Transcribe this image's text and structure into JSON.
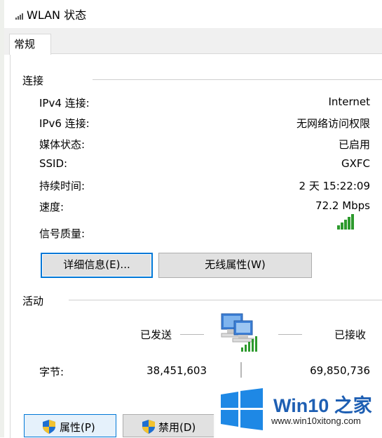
{
  "window": {
    "title": "WLAN 状态"
  },
  "tabs": [
    {
      "label": "常规"
    }
  ],
  "connection": {
    "section_label": "连接",
    "rows": [
      {
        "label": "IPv4 连接:",
        "value": "Internet"
      },
      {
        "label": "IPv6 连接:",
        "value": "无网络访问权限"
      },
      {
        "label": "媒体状态:",
        "value": "已启用"
      },
      {
        "label": "SSID:",
        "value": "GXFC"
      },
      {
        "label": "持续时间:",
        "value": "2 天 15:22:09"
      },
      {
        "label": "速度:",
        "value": "72.2 Mbps"
      }
    ],
    "signal_label": "信号质量:",
    "signal_bars": 5,
    "buttons": {
      "details": "详细信息(E)...",
      "wireless_properties": "无线属性(W)"
    }
  },
  "activity": {
    "section_label": "活动",
    "sent_label": "已发送",
    "received_label": "已接收",
    "bytes_label": "字节:",
    "bytes_sent": "38,451,603",
    "bytes_received": "69,850,736"
  },
  "footer": {
    "properties_button": "属性(P)",
    "disable_button": "禁用(D)"
  },
  "watermark": {
    "title": "Win10 之家",
    "url": "www.win10xitong.com"
  },
  "colors": {
    "focus": "#0078d7",
    "signal": "#2d9a2d",
    "brand": "#1e5fb3"
  }
}
